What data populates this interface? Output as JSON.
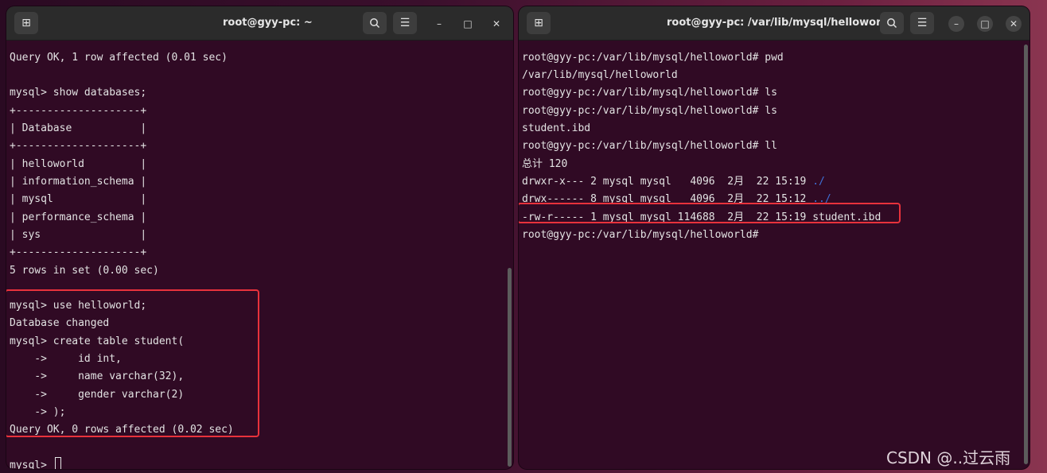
{
  "left_window": {
    "title": "root@gyy-pc: ~",
    "new_tab_icon": "new-tab-icon",
    "search_icon": "search-icon",
    "menu_icon": "hamburger-menu-icon",
    "minimize_label": "–",
    "maximize_label": "□",
    "close_label": "✕",
    "lines": [
      "Query OK, 1 row affected (0.01 sec)",
      "",
      "mysql> show databases;",
      "+--------------------+",
      "| Database           |",
      "+--------------------+",
      "| helloworld         |",
      "| information_schema |",
      "| mysql              |",
      "| performance_schema |",
      "| sys                |",
      "+--------------------+",
      "5 rows in set (0.00 sec)",
      "",
      "mysql> use helloworld;",
      "Database changed",
      "mysql> create table student(",
      "    ->     id int,",
      "    ->     name varchar(32),",
      "    ->     gender varchar(2)",
      "    -> );",
      "Query OK, 0 rows affected (0.02 sec)",
      "",
      "mysql> "
    ]
  },
  "right_window": {
    "title": "root@gyy-pc: /var/lib/mysql/helloworld",
    "new_tab_icon": "new-tab-icon",
    "search_icon": "search-icon",
    "menu_icon": "hamburger-menu-icon",
    "minimize_label": "–",
    "maximize_label": "□",
    "close_label": "✕",
    "lines": [
      "root@gyy-pc:/var/lib/mysql/helloworld# pwd",
      "/var/lib/mysql/helloworld",
      "root@gyy-pc:/var/lib/mysql/helloworld# ls",
      "root@gyy-pc:/var/lib/mysql/helloworld# ls",
      "student.ibd",
      "root@gyy-pc:/var/lib/mysql/helloworld# ll",
      "总计 120",
      "drwxr-x--- 2 mysql mysql   4096  2月  22 15:19 ",
      "drwx------ 8 mysql mysql   4096  2月  22 15:12 ",
      "-rw-r----- 1 mysql mysql 114688  2月  22 15:19 student.ibd",
      "root@gyy-pc:/var/lib/mysql/helloworld#"
    ],
    "dir_self": "./",
    "dir_parent": "../"
  },
  "watermark": "CSDN @..过云雨",
  "colors": {
    "terminal_bg": "#300a24",
    "highlight_border": "#e8323c",
    "dir_link": "#3f70d8"
  }
}
